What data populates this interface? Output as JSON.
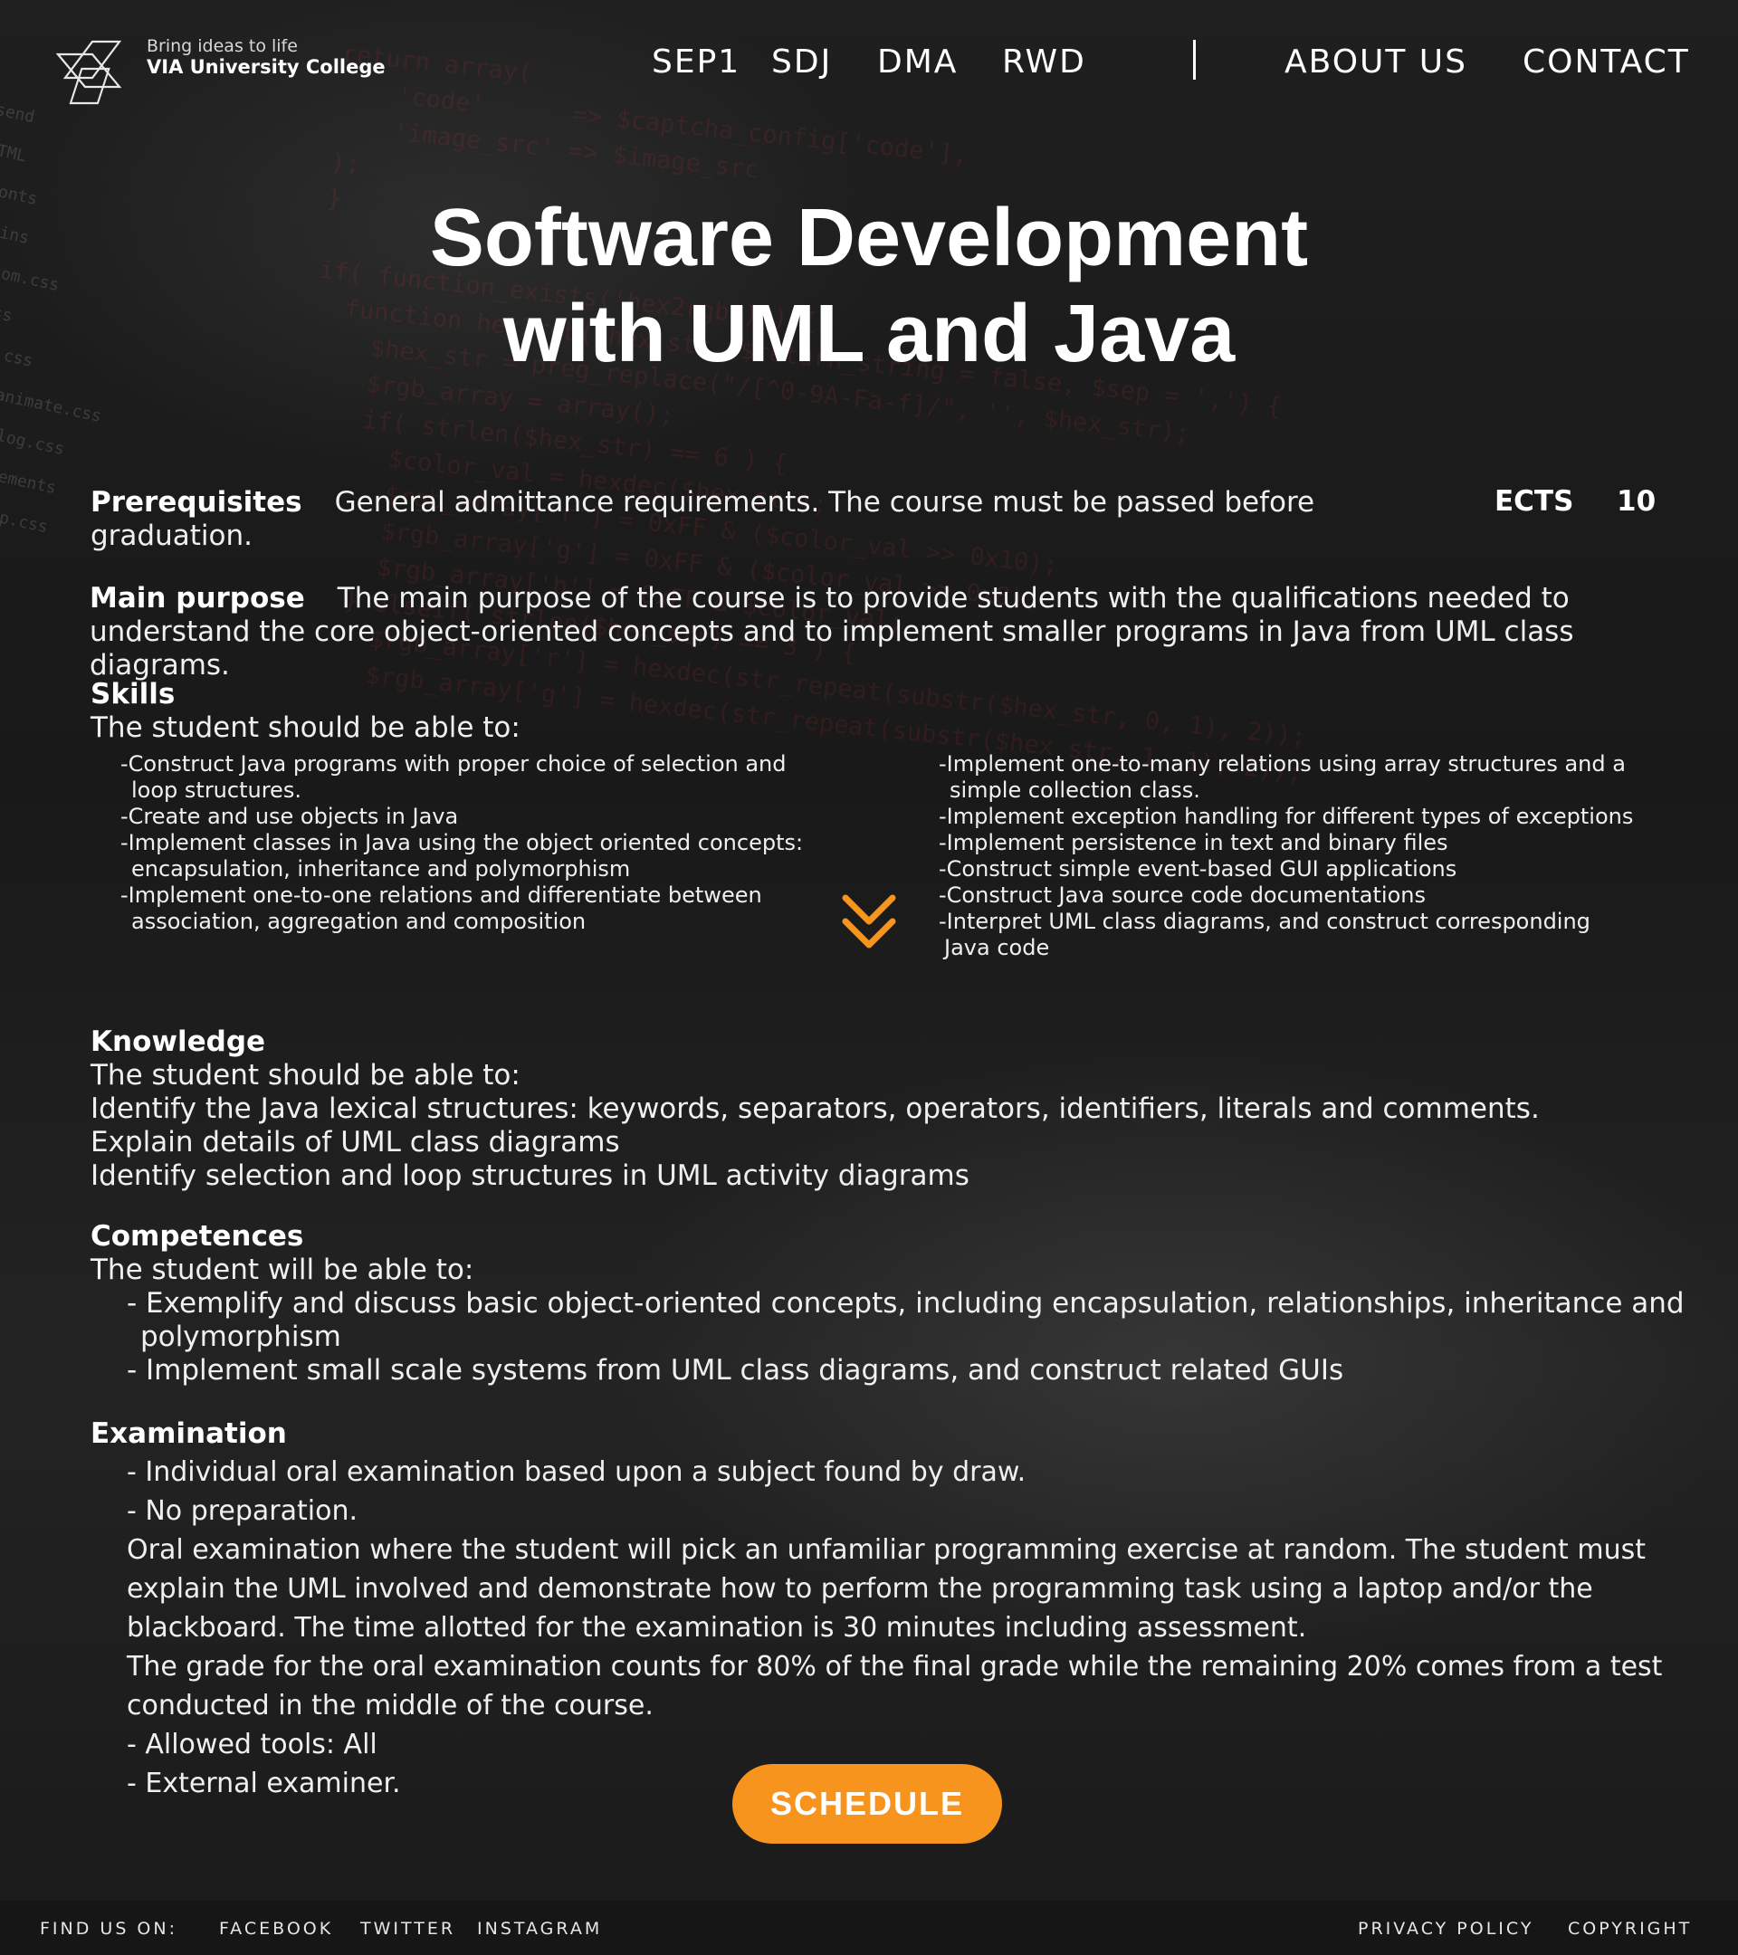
{
  "brand": {
    "tagline": "Bring ideas to life",
    "name": "VIA University College"
  },
  "nav": {
    "items": [
      "SEP1",
      "SDJ",
      "DMA",
      "RWD"
    ],
    "about": "ABOUT US",
    "contact": "CONTACT"
  },
  "title": {
    "line1": "Software Development",
    "line2": "with UML and Java"
  },
  "prerequisites": {
    "label": "Prerequisites",
    "text_line1": "General admittance requirements. The course must be passed before",
    "text_line2": "graduation."
  },
  "ects": {
    "label": "ECTS",
    "value": "10"
  },
  "main_purpose": {
    "label": "Main purpose",
    "line1": "The main purpose of the course is to provide students with the qualifications needed to",
    "line2": "understand the core object-oriented concepts and to implement smaller programs in Java from UML class",
    "line3": "diagrams."
  },
  "skills": {
    "label": "Skills",
    "intro": "The student should be able to:",
    "left": [
      "-Construct Java programs with proper choice of selection and",
      "  loop structures.",
      "-Create and use objects in Java",
      "-Implement classes in Java using the object oriented concepts:",
      "  encapsulation, inheritance and polymorphism",
      "-Implement one-to-one relations and differentiate between",
      "  association, aggregation and composition"
    ],
    "right": [
      "-Implement one-to-many relations using array structures and a",
      "  simple collection class.",
      "-Implement exception handling for different types of exceptions",
      "-Implement persistence in text and binary files",
      "-Construct simple event-based GUI applications",
      "-Construct Java source code documentations",
      "-Interpret UML class diagrams, and construct corresponding",
      " Java code"
    ]
  },
  "knowledge": {
    "label": "Knowledge",
    "intro": "The student should be able to:",
    "lines": [
      "Identify the Java lexical structures: keywords, separators, operators, identifiers, literals and comments.",
      "Explain details of UML class diagrams",
      "Identify selection and loop structures in UML activity diagrams"
    ]
  },
  "competences": {
    "label": "Competences",
    "intro": "The student will be able to:",
    "lines": [
      "- Exemplify and discuss basic object-oriented concepts, including encapsulation, relationships, inheritance and",
      "  polymorphism",
      "- Implement small scale systems from UML class diagrams, and construct related GUIs"
    ]
  },
  "examination": {
    "label": "Examination",
    "lines": [
      "- Individual oral examination based upon a subject found by draw.",
      "- No preparation.",
      "Oral examination where the student will pick an unfamiliar programming exercise at random. The student must",
      "explain the UML involved and demonstrate how to perform the programming task using a laptop and/or the",
      "blackboard. The time allotted for the examination is 30 minutes including assessment.",
      "The grade for the oral examination counts for 80% of the final grade while the remaining 20% comes from a test",
      "conducted in the middle of the course.",
      "- Allowed tools: All",
      "- External examiner."
    ]
  },
  "schedule_button": "SCHEDULE",
  "footer": {
    "find_us": "FIND US ON:",
    "facebook": "FACEBOOK",
    "twitter": "TWITTER",
    "instagram": "INSTAGRAM",
    "privacy": "PRIVACY POLICY",
    "copyright": "COPYRIGHT"
  },
  "colors": {
    "accent": "#f7941d",
    "background": "#1c1c1c",
    "text": "#ffffff"
  },
  "icons": {
    "scroll": "double-chevron-down-icon",
    "logo": "via-logo-icon"
  }
}
